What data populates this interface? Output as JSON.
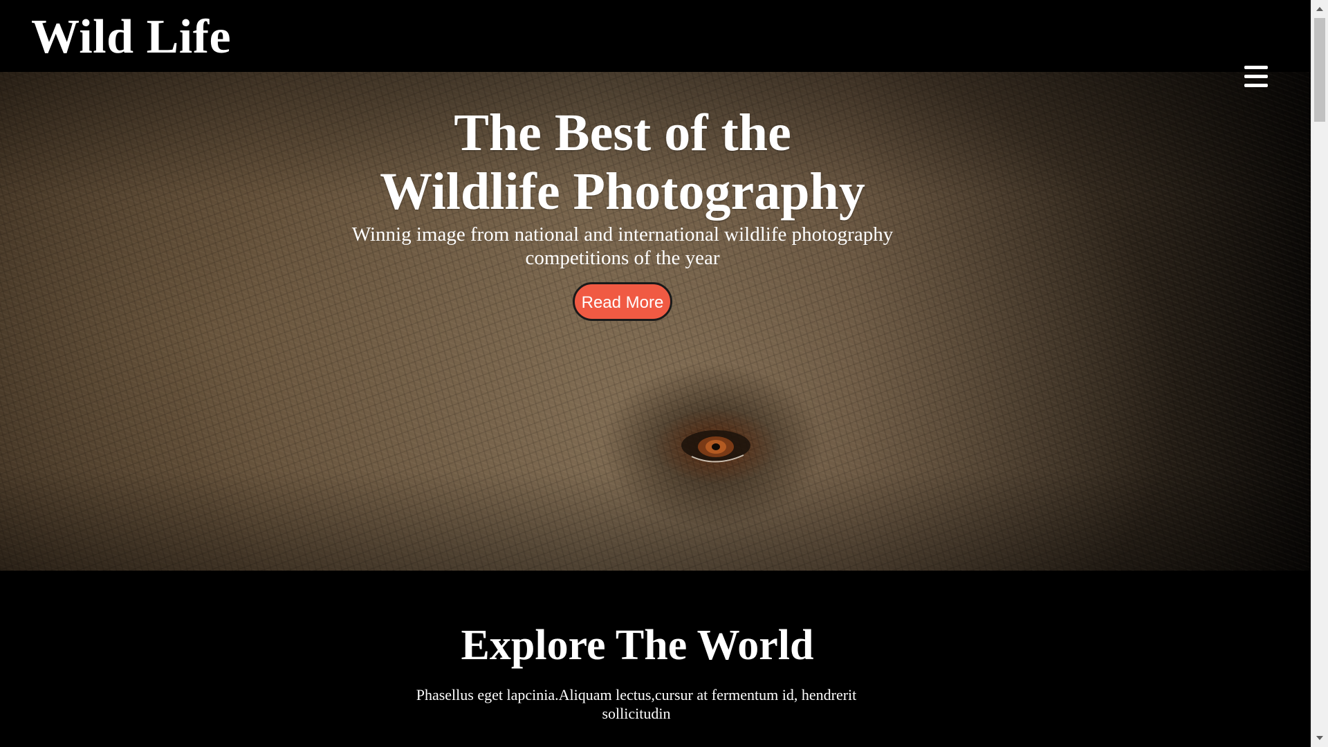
{
  "header": {
    "logo": "Wild Life",
    "menu_icon": "hamburger-menu-icon"
  },
  "hero": {
    "title": "The Best of the\nWildlife Photography",
    "subtitle": "Winnig image from national and international wildlife photography competitions of the year",
    "button_label": "Read More",
    "button_color": "#f05a43"
  },
  "explore": {
    "title": "Explore The World",
    "text": "Phasellus eget lapcinia.Aliquam lectus,cursur at fermentum id, hendrerit sollicitudin"
  },
  "colors": {
    "background": "#000000",
    "text": "#ffffff",
    "accent": "#f05a43"
  }
}
